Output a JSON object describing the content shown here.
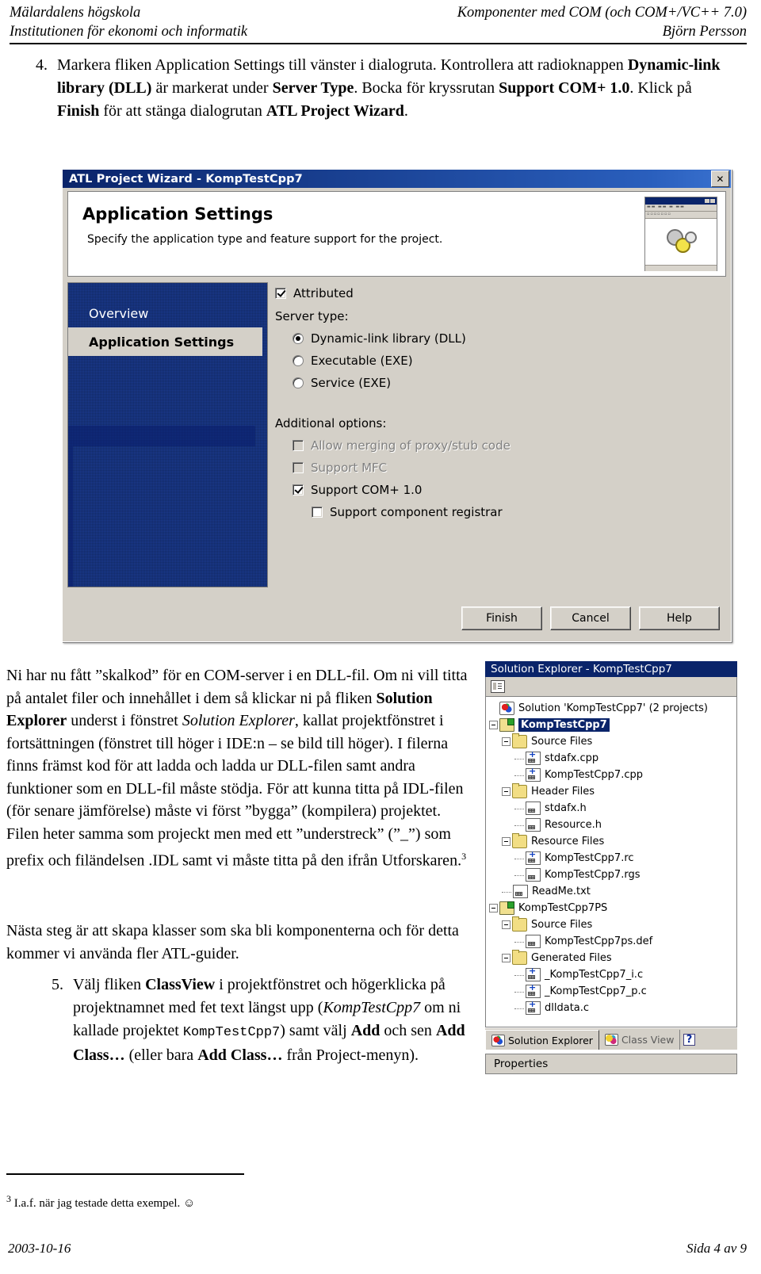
{
  "header": {
    "left_line1": "Mälardalens högskola",
    "left_line2": "Institutionen för ekonomi och informatik",
    "right_line1": "Komponenter med COM  (och COM+/VC++ 7.0)",
    "right_line2": "Björn Persson"
  },
  "item4": {
    "number": "4.",
    "p1": "Markera fliken Application Settings till vänster i dialogruta. Kontrollera att radioknappen ",
    "b1": "Dynamic-link library (DLL)",
    "p2": " är markerat under ",
    "b2": "Server Type",
    "p3": ". Bocka för kryssrutan ",
    "b3": "Support COM+ 1.0",
    "p4": ". Klick på ",
    "b4": "Finish",
    "p5": " för att stänga dialogrutan ",
    "b5": "ATL Project Wizard",
    "p6": "."
  },
  "wizard": {
    "title": "ATL Project Wizard - KompTestCpp7",
    "close_label": "✕",
    "banner_heading": "Application Settings",
    "banner_text": "Specify the application type and feature support for the project.",
    "nav": [
      {
        "label": "Overview",
        "selected": false
      },
      {
        "label": "Application Settings",
        "selected": true
      }
    ],
    "attributed_label": "Attributed",
    "attributed_checked": true,
    "server_type_label": "Server type:",
    "server_types": [
      {
        "label": "Dynamic-link library (DLL)",
        "selected": true
      },
      {
        "label": "Executable (EXE)",
        "selected": false
      },
      {
        "label": "Service (EXE)",
        "selected": false
      }
    ],
    "additional_label": "Additional options:",
    "additional": [
      {
        "label": "Allow merging of proxy/stub code",
        "checked": false,
        "disabled": true,
        "indent": 1
      },
      {
        "label": "Support MFC",
        "checked": false,
        "disabled": true,
        "indent": 1
      },
      {
        "label": "Support COM+ 1.0",
        "checked": true,
        "disabled": false,
        "indent": 1
      },
      {
        "label": "Support component registrar",
        "checked": false,
        "disabled": false,
        "indent": 2
      }
    ],
    "buttons": [
      {
        "label": "Finish"
      },
      {
        "label": "Cancel"
      },
      {
        "label": "Help"
      }
    ]
  },
  "para_a": {
    "t1": "Ni har nu fått ”skalkod” för en COM-server i en DLL-fil. Om ni vill titta på antalet filer och innehållet i dem så klickar ni på fliken ",
    "b1": "Solution Explorer",
    "t2": " underst i fönstret ",
    "i1": "Solution Explorer",
    "t3": ", kallat projektfönstret i fortsättningen (fönstret till höger i IDE:n – se bild till höger). I filerna finns främst kod för att ladda och ladda ur DLL-filen samt andra funktioner som en DLL-fil måste stödja. För att kunna titta på IDL-filen (för senare jämförelse) måste vi först ”bygga” (kompilera) projektet. Filen heter samma som projeckt men med ett ”understreck” (”_”) som prefix och filändelsen .IDL samt vi måste titta på den ifrån Utforskaren.",
    "sup": "3"
  },
  "para_b": {
    "text": "Nästa steg är att skapa klasser som ska bli komponenterna och för detta kommer vi använda fler ATL-guider."
  },
  "item5": {
    "number": "5.",
    "t1": "Välj fliken ",
    "b1": "ClassView",
    "t2": " i projektfönstret och högerklicka på projektnamnet med fet text längst upp (",
    "i1": "KompTestCpp7",
    "t3": " om ni kallade projektet ",
    "m1": "KompTestCpp7",
    "t4": ") samt välj ",
    "b2": "Add",
    "t5": " och sen ",
    "b3": "Add Class…",
    "t6": " (eller bara ",
    "b4": "Add Class…",
    "t7": " från Project-menyn)."
  },
  "solution_explorer": {
    "title": "Solution Explorer - KompTestCpp7",
    "tree": [
      {
        "label": "Solution 'KompTestCpp7' (2 projects)",
        "indent": 1,
        "icon": "solution-icon",
        "toggle": "none",
        "selected": false
      },
      {
        "label": "KompTestCpp7",
        "indent": 1,
        "icon": "project-icon",
        "toggle": "minus",
        "selected": true
      },
      {
        "label": "Source Files",
        "indent": 2,
        "icon": "folder-icon",
        "toggle": "minus",
        "selected": false
      },
      {
        "label": "stdafx.cpp",
        "indent": 3,
        "icon": "cpp-file-icon",
        "toggle": "none",
        "selected": false
      },
      {
        "label": "KompTestCpp7.cpp",
        "indent": 3,
        "icon": "cpp-file-icon",
        "toggle": "none",
        "selected": false
      },
      {
        "label": "Header Files",
        "indent": 2,
        "icon": "folder-icon",
        "toggle": "minus",
        "selected": false
      },
      {
        "label": "stdafx.h",
        "indent": 3,
        "icon": "file-icon",
        "toggle": "none",
        "selected": false
      },
      {
        "label": "Resource.h",
        "indent": 3,
        "icon": "file-icon",
        "toggle": "none",
        "selected": false
      },
      {
        "label": "Resource Files",
        "indent": 2,
        "icon": "folder-icon",
        "toggle": "minus",
        "selected": false
      },
      {
        "label": "KompTestCpp7.rc",
        "indent": 3,
        "icon": "cpp-file-icon",
        "toggle": "none",
        "selected": false
      },
      {
        "label": "KompTestCpp7.rgs",
        "indent": 3,
        "icon": "file-icon",
        "toggle": "none",
        "selected": false
      },
      {
        "label": "ReadMe.txt",
        "indent": 2,
        "icon": "file-icon",
        "toggle": "none",
        "selected": false
      },
      {
        "label": "KompTestCpp7PS",
        "indent": 1,
        "icon": "project-icon",
        "toggle": "minus",
        "selected": false
      },
      {
        "label": "Source Files",
        "indent": 2,
        "icon": "folder-icon",
        "toggle": "minus",
        "selected": false
      },
      {
        "label": "KompTestCpp7ps.def",
        "indent": 3,
        "icon": "file-icon",
        "toggle": "none",
        "selected": false
      },
      {
        "label": "Generated Files",
        "indent": 2,
        "icon": "folder-icon",
        "toggle": "minus",
        "selected": false
      },
      {
        "label": "_KompTestCpp7_i.c",
        "indent": 3,
        "icon": "cpp-file-icon",
        "toggle": "none",
        "selected": false
      },
      {
        "label": "_KompTestCpp7_p.c",
        "indent": 3,
        "icon": "cpp-file-icon",
        "toggle": "none",
        "selected": false
      },
      {
        "label": "dlldata.c",
        "indent": 3,
        "icon": "cpp-file-icon",
        "toggle": "none",
        "selected": false
      }
    ],
    "tabs": [
      {
        "label": "Solution Explorer",
        "active": true,
        "icon": "solution-icon"
      },
      {
        "label": "Class View",
        "active": false,
        "icon": "class-view-icon"
      }
    ],
    "help_tab_label": "?",
    "properties_label": "Properties"
  },
  "footnote": {
    "marker": "3",
    "text": " I.a.f. när jag testade detta exempel. ☺"
  },
  "footer": {
    "date": "2003-10-16",
    "page": "Sida 4 av 9"
  }
}
